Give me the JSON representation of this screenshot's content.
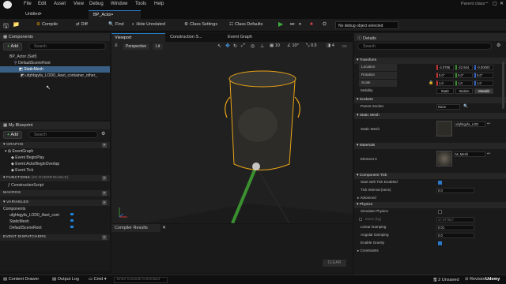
{
  "menu": {
    "items": [
      "File",
      "Edit",
      "Asset",
      "View",
      "Debug",
      "Window",
      "Tools",
      "Help"
    ],
    "parent_class_label": "Parent class"
  },
  "tabs": [
    {
      "label": "Untitled•"
    },
    {
      "label": "BP_Actor•"
    }
  ],
  "toolbar": {
    "compile": "Compile",
    "diff": "Diff",
    "find": "Find",
    "hide_unrelated": "Hide Unrelated",
    "class_settings": "Class Settings",
    "class_defaults": "Class Defaults",
    "debug_object": "No debug object selected"
  },
  "components_panel": {
    "title": "Components",
    "add_label": "Add",
    "search_placeholder": "Search",
    "tree": [
      {
        "label": "BP_Actor (Self)"
      },
      {
        "label": "DefaultSceneRoot"
      },
      {
        "label": "StaticMesh"
      },
      {
        "label": "ufghbgyfa_LOD0_Aset_container_other_"
      }
    ]
  },
  "blueprint_panel": {
    "title": "My Blueprint",
    "add_label": "Add",
    "search_placeholder": "Search",
    "sections": {
      "graphs": "GRAPHS",
      "functions": "FUNCTIONS",
      "functions_count": "(23 OVERRIDABLE)",
      "macros": "MACROS",
      "variables": "VARIABLES",
      "event_dispatchers": "EVENT DISPATCHERS"
    },
    "event_graph": "EventGraph",
    "events": [
      "Event BeginPlay",
      "Event ActorBeginOverlap",
      "Event Tick"
    ],
    "function_items": [
      "ConstructionScript"
    ],
    "components_label": "Components",
    "variables": [
      "ufghbgyfa_LOD0_Aset_cont",
      "StaticMesh",
      "DefaultSceneRoot"
    ]
  },
  "viewport": {
    "tabs": [
      "Viewport",
      "Construction S...",
      "Event Graph"
    ],
    "perspective": "Perspective",
    "lit": "Lit",
    "grid_snap": "10",
    "rot_snap": "10°",
    "scale_snap": "0.5",
    "camera_speed": "4"
  },
  "compiler": {
    "title": "Compiler Results",
    "clear": "CLEAR"
  },
  "details": {
    "title": "Details",
    "search_placeholder": "Search",
    "transform": "Transform",
    "location_label": "Location",
    "location": [
      "-4.0796",
      "-22.944",
      "-0.00000"
    ],
    "rotation_label": "Rotation",
    "rotation": [
      "0.0°",
      "0.0°",
      "0.0°"
    ],
    "scale_label": "Scale",
    "scale": [
      "1.0",
      "1.0",
      "1.0"
    ],
    "mobility_label": "Mobility",
    "mobility": [
      "Static",
      "Station",
      "Movabl"
    ],
    "sockets": "Sockets",
    "parent_socket_label": "Parent Socket",
    "parent_socket": "None",
    "static_mesh_section": "Static Mesh",
    "static_mesh_label": "Static Mesh",
    "static_mesh_value": "ufghbgyfa_LOD",
    "materials": "Materials",
    "element0_label": "Element 0",
    "element0_value": "M_Mesh",
    "component_tick": "Component Tick",
    "start_tick_label": "Start with Tick Enabled",
    "tick_interval_label": "Tick Interval (secs)",
    "tick_interval": "0.0",
    "advanced": "Advanced",
    "physics": "Physics",
    "simulate_label": "Simulate Physics",
    "mass_label": "Mass (kg)",
    "mass": "37.077927",
    "linear_damping_label": "Linear Damping",
    "linear_damping": "0.01",
    "angular_damping_label": "Angular Damping",
    "angular_damping": "0.0",
    "gravity_label": "Enable Gravity",
    "constraints": "Constraints"
  },
  "statusbar": {
    "content_drawer": "Content Drawer",
    "output_log": "Output Log",
    "cmd": "Cmd",
    "console_placeholder": "Enter Console Command",
    "unsaved": "2 Unsaved",
    "revision": "Revision",
    "watermark": "Udemy"
  },
  "colors": {
    "accent": "#2a7cc7",
    "add_green": "#4caf50",
    "play_green": "#3fae3f",
    "selection_orange": "#e8a317",
    "var_blue": "#1e88e5"
  }
}
